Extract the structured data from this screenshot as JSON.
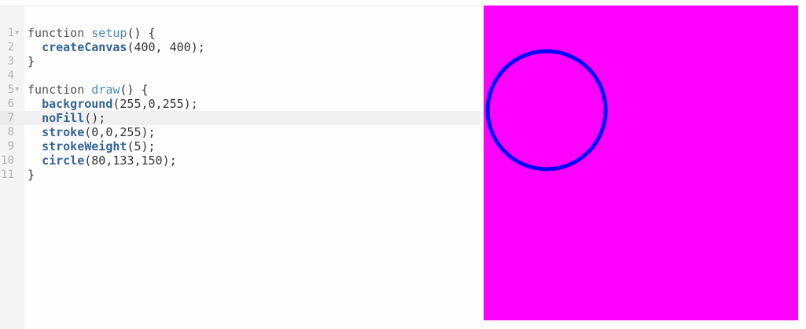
{
  "editor": {
    "active_line": 7,
    "lines": [
      {
        "num": "1",
        "fold": "▼",
        "parts": [
          {
            "t": "function ",
            "c": "kw"
          },
          {
            "t": "setup",
            "c": "fnname"
          },
          {
            "t": "() {",
            "c": "plain"
          }
        ]
      },
      {
        "num": "2",
        "fold": "",
        "parts": [
          {
            "t": "  ",
            "c": "plain"
          },
          {
            "t": "createCanvas",
            "c": "call"
          },
          {
            "t": "(400, 400);",
            "c": "plain"
          }
        ]
      },
      {
        "num": "3",
        "fold": "",
        "parts": [
          {
            "t": "}",
            "c": "plain"
          }
        ]
      },
      {
        "num": "4",
        "fold": "",
        "parts": []
      },
      {
        "num": "5",
        "fold": "▼",
        "parts": [
          {
            "t": "function ",
            "c": "kw"
          },
          {
            "t": "draw",
            "c": "fnname"
          },
          {
            "t": "() {",
            "c": "plain"
          }
        ]
      },
      {
        "num": "6",
        "fold": "",
        "parts": [
          {
            "t": "  ",
            "c": "plain"
          },
          {
            "t": "background",
            "c": "call"
          },
          {
            "t": "(255,0,255);",
            "c": "plain"
          }
        ]
      },
      {
        "num": "7",
        "fold": "",
        "parts": [
          {
            "t": "  ",
            "c": "plain"
          },
          {
            "t": "noFill",
            "c": "call"
          },
          {
            "t": "();",
            "c": "plain"
          }
        ]
      },
      {
        "num": "8",
        "fold": "",
        "parts": [
          {
            "t": "  ",
            "c": "plain"
          },
          {
            "t": "stroke",
            "c": "call"
          },
          {
            "t": "(0,0,255);",
            "c": "plain"
          }
        ]
      },
      {
        "num": "9",
        "fold": "",
        "parts": [
          {
            "t": "  ",
            "c": "plain"
          },
          {
            "t": "strokeWeight",
            "c": "call"
          },
          {
            "t": "(5);",
            "c": "plain"
          }
        ]
      },
      {
        "num": "10",
        "fold": "",
        "parts": [
          {
            "t": "  ",
            "c": "plain"
          },
          {
            "t": "circle",
            "c": "call"
          },
          {
            "t": "(80,133,150);",
            "c": "plain"
          }
        ]
      },
      {
        "num": "11",
        "fold": "",
        "parts": [
          {
            "t": "}",
            "c": "plain"
          }
        ]
      }
    ]
  },
  "preview": {
    "background_color": "#ff00ff",
    "stroke_color": "#0000ff"
  }
}
